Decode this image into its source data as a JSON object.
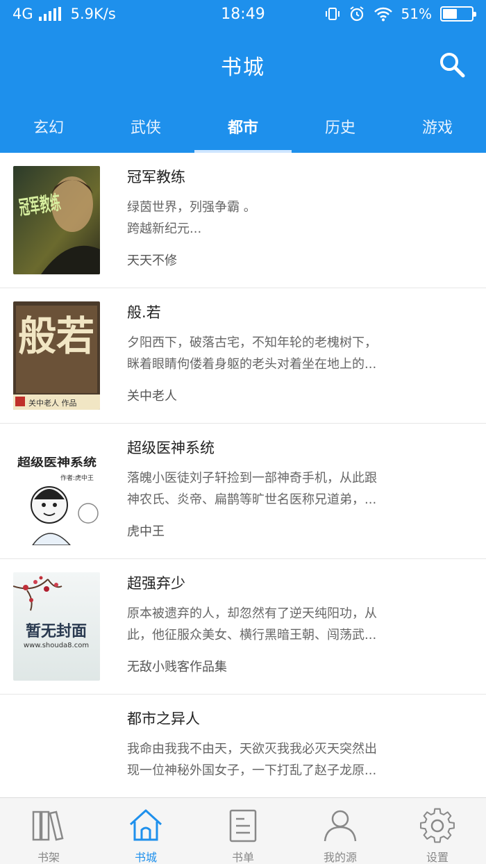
{
  "status_bar": {
    "network": "4G",
    "speed": "5.9K/s",
    "time": "18:49",
    "battery": "51%",
    "battery_level": 0.51
  },
  "header": {
    "title": "书城",
    "search_icon": "search-icon"
  },
  "tabs": [
    {
      "label": "玄幻",
      "active": false
    },
    {
      "label": "武侠",
      "active": false
    },
    {
      "label": "都市",
      "active": true
    },
    {
      "label": "历史",
      "active": false
    },
    {
      "label": "游戏",
      "active": false
    }
  ],
  "books": [
    {
      "title": "冠军教练",
      "desc_line1": "绿茵世界，列强争霸 。",
      "desc_line2": "跨越新纪元...",
      "author": "天天不修",
      "cover_text": "冠军教练"
    },
    {
      "title": "般.若",
      "desc_line1": "夕阳西下，破落古宅，不知年轮的老槐树下，",
      "desc_line2": "眯着眼睛佝偻着身躯的老头对着坐在地上的...",
      "author": "关中老人",
      "cover_text": "般若",
      "cover_sub": "关中老人 作品"
    },
    {
      "title": "超级医神系统",
      "desc_line1": "落魄小医徒刘子轩捡到一部神奇手机，从此跟",
      "desc_line2": "神农氏、炎帝、扁鹊等旷世名医称兄道弟，...",
      "author": "虎中王",
      "cover_text": "超级医神系统",
      "cover_sub": "作者:虎中王"
    },
    {
      "title": "超强弃少",
      "desc_line1": "原本被遗弃的人，却忽然有了逆天纯阳功，从",
      "desc_line2": "此，他征服众美女、横行黑暗王朝、闯荡武...",
      "author": "无敌小贱客作品集",
      "cover_text": "暂无封面",
      "cover_sub": "www.shouda8.com"
    },
    {
      "title": "都市之异人",
      "desc_line1": "我命由我我不由天，天欲灭我我必灭天突然出",
      "desc_line2": "现一位神秘外国女子，一下打乱了赵子龙原...",
      "author": "",
      "cover_text": ""
    }
  ],
  "bottom_nav": [
    {
      "label": "书架",
      "icon": "bookshelf-icon",
      "active": false
    },
    {
      "label": "书城",
      "icon": "home-icon",
      "active": true
    },
    {
      "label": "书单",
      "icon": "list-doc-icon",
      "active": false
    },
    {
      "label": "我的源",
      "icon": "user-icon",
      "active": false
    },
    {
      "label": "设置",
      "icon": "gear-icon",
      "active": false
    }
  ],
  "colors": {
    "primary": "#1e90ec",
    "nav_inactive": "#888888"
  }
}
